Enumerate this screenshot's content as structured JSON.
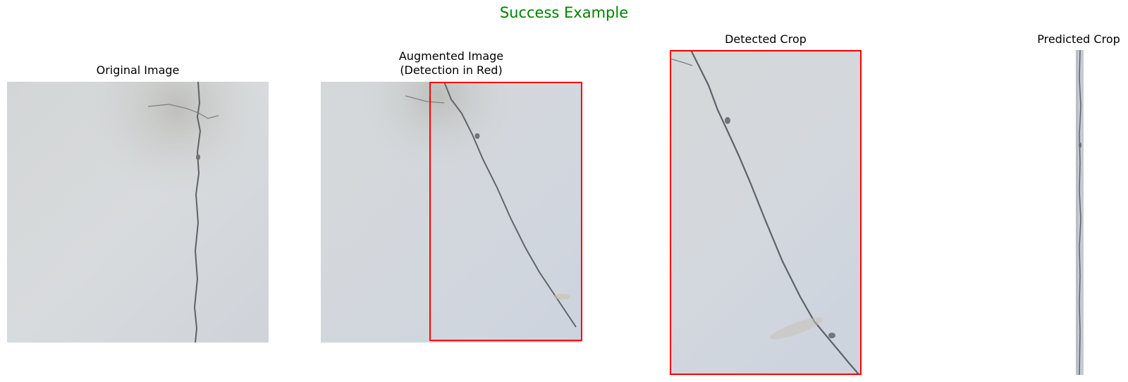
{
  "figure": {
    "suptitle": "Success Example",
    "suptitle_color": "#008000",
    "detection_color": "#ff0000",
    "panels": [
      {
        "title": "Original Image"
      },
      {
        "title_line1": "Augmented Image",
        "title_line2": "(Detection in Red)"
      },
      {
        "title": "Detected Crop"
      },
      {
        "title": "Predicted Crop"
      }
    ]
  }
}
